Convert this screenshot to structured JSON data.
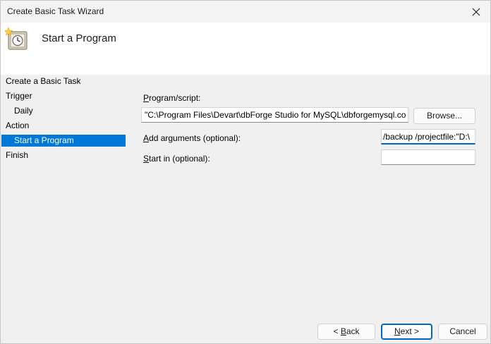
{
  "window": {
    "title": "Create Basic Task Wizard",
    "header": "Start a Program"
  },
  "steps": [
    {
      "label": "Create a Basic Task"
    },
    {
      "label": "Trigger"
    },
    {
      "label": "Daily"
    },
    {
      "label": "Action"
    },
    {
      "label": "Start a Program"
    },
    {
      "label": "Finish"
    }
  ],
  "form": {
    "program_label": "rogram/script:",
    "program_label_accel": "P",
    "program_value": "\"C:\\Program Files\\Devart\\dbForge Studio for MySQL\\dbforgemysql.co",
    "browse_label": "Browse...",
    "args_label": "dd arguments (optional):",
    "args_label_accel": "A",
    "args_value": "/backup /projectfile:\"D:\\",
    "start_label": "tart in (optional):",
    "start_label_accel": "S",
    "start_value": ""
  },
  "buttons": {
    "back_accel": "B",
    "back_rest": "ack",
    "back_prefix": "< ",
    "next_accel": "N",
    "next_rest": "ext",
    "next_suffix": " >",
    "cancel": "Cancel"
  },
  "colors": {
    "accent": "#0067c0",
    "selection": "#0078d7"
  }
}
